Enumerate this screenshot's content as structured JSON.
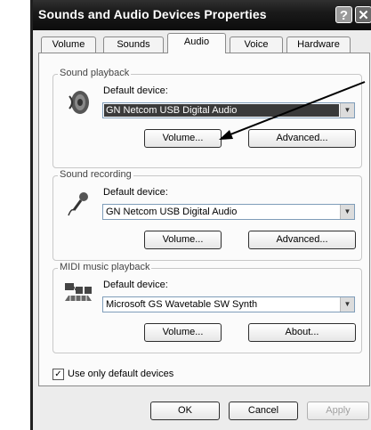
{
  "window": {
    "title": "Sounds and Audio Devices Properties",
    "help_glyph": "?",
    "close_glyph": "✕"
  },
  "tabs": [
    {
      "label": "Volume"
    },
    {
      "label": "Sounds"
    },
    {
      "label": "Audio"
    },
    {
      "label": "Voice"
    },
    {
      "label": "Hardware"
    }
  ],
  "active_tab": "Audio",
  "sound_playback": {
    "group_label": "Sound playback",
    "default_device_label": "Default device:",
    "device_value": "GN Netcom USB Digital Audio",
    "volume_button": "Volume...",
    "advanced_button": "Advanced..."
  },
  "sound_recording": {
    "group_label": "Sound recording",
    "default_device_label": "Default device:",
    "device_value": "GN Netcom USB Digital Audio",
    "volume_button": "Volume...",
    "advanced_button": "Advanced..."
  },
  "midi_playback": {
    "group_label": "MIDI music playback",
    "default_device_label": "Default device:",
    "device_value": "Microsoft GS Wavetable SW Synth",
    "volume_button": "Volume...",
    "about_button": "About..."
  },
  "use_only_default": {
    "label": "Use only default devices",
    "checked": true,
    "check_glyph": "✓"
  },
  "footer": {
    "ok_button": "OK",
    "cancel_button": "Cancel",
    "apply_button": "Apply"
  },
  "icons": {
    "speaker": "speaker-icon",
    "microphone": "microphone-icon",
    "midi": "midi-keyboard-icon",
    "dropdown": "chevron-down-icon"
  }
}
